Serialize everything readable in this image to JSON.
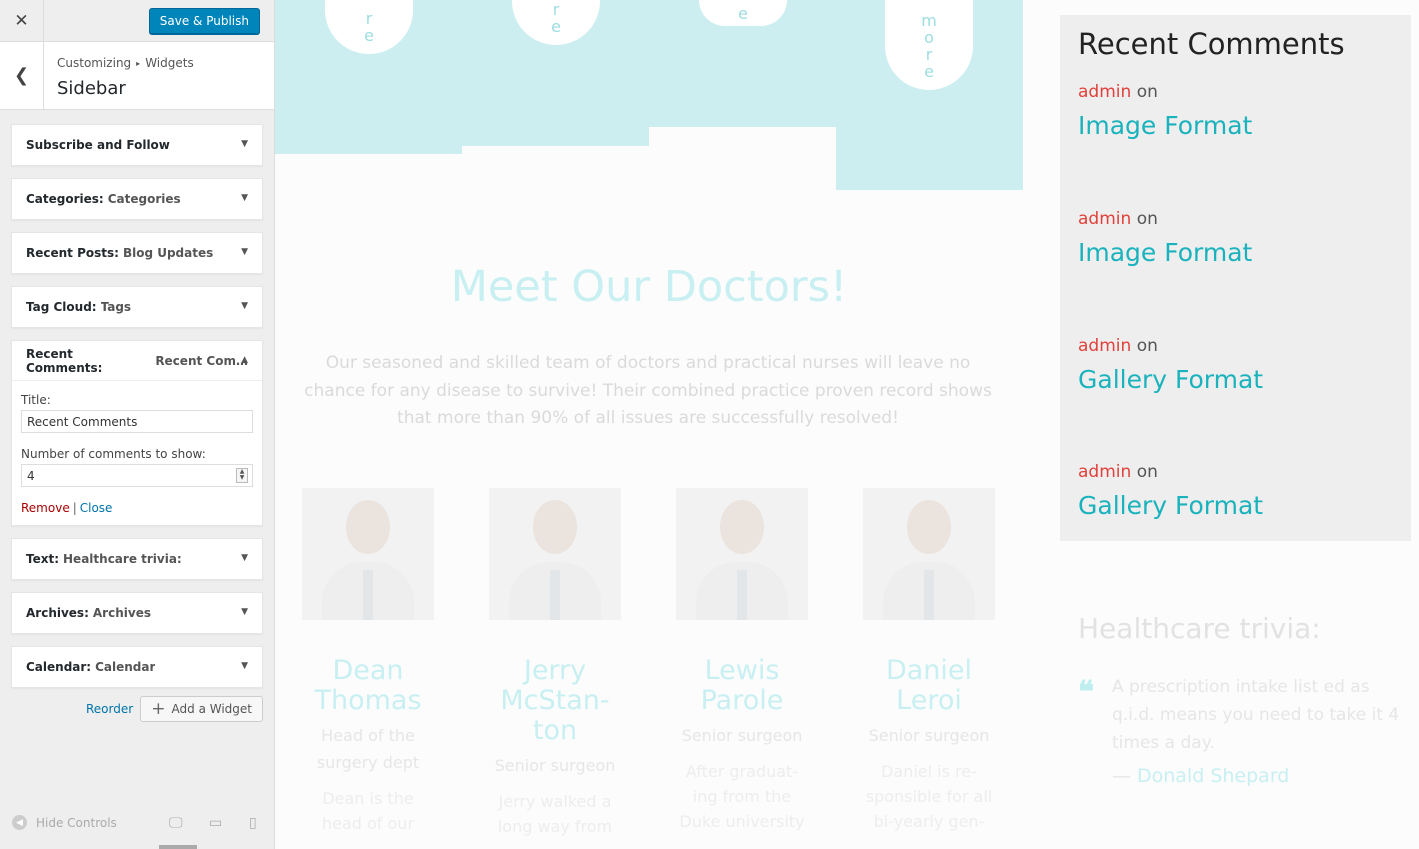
{
  "customizer": {
    "close_glyph": "✕",
    "publish_label": "Save & Publish",
    "back_glyph": "❮",
    "breadcrumb": [
      "Customizing",
      "Widgets"
    ],
    "breadcrumb_sep": "▸",
    "section_title": "Sidebar",
    "widgets": [
      {
        "type": "Subscribe and Follow",
        "title": "",
        "open": false
      },
      {
        "type": "Categories:",
        "title": "Categories",
        "open": false
      },
      {
        "type": "Recent Posts:",
        "title": "Blog Updates",
        "open": false
      },
      {
        "type": "Tag Cloud:",
        "title": "Tags",
        "open": false
      },
      {
        "type": "Recent Comments:",
        "title": "Recent Com...",
        "open": true
      },
      {
        "type": "Text:",
        "title": "Healthcare trivia:",
        "open": false
      },
      {
        "type": "Archives:",
        "title": "Archives",
        "open": false
      },
      {
        "type": "Calendar:",
        "title": "Calendar",
        "open": false
      }
    ],
    "open_widget_form": {
      "title_label": "Title:",
      "title_value": "Recent Comments",
      "count_label": "Number of comments to show:",
      "count_value": "4",
      "remove_label": "Remove",
      "separator": "|",
      "close_label": "Close"
    },
    "toggle_closed_glyph": "▼",
    "toggle_open_glyph": "▲",
    "reorder_label": "Reorder",
    "add_widget_label": "Add a Widget",
    "add_glyph": "+",
    "hide_controls_label": "Hide Controls",
    "hide_glyph": "◀",
    "device_glyphs": {
      "desktop": "🖵",
      "tablet": "▭",
      "mobile": "▯"
    }
  },
  "preview": {
    "pill_texts": [
      "r\ne",
      "r\ne",
      "e",
      "m\no\nr\ne"
    ],
    "meet_title": "Meet Our Doctors!",
    "meet_desc": "Our seasoned and skilled team of doctors and practical nurses will leave no chance for any disease to survive! Their combined practice proven record shows that more than 90% of all issues are successfully resolved!",
    "doctors": [
      {
        "name": "Dean\nThomas",
        "role": "Head of the\nsurgery dept",
        "bio": "Dean is the\nhead of our"
      },
      {
        "name": "Jerry\nMcStan-\nton",
        "role": "Senior surgeon",
        "bio": "Jerry walked a\nlong way from"
      },
      {
        "name": "Lewis\nParole",
        "role": "Senior surgeon",
        "bio": "After graduat-\ning from the\nDuke university"
      },
      {
        "name": "Daniel\nLeroi",
        "role": "Senior surgeon",
        "bio": "Daniel is re-\nsponsible for all\nbi-yearly gen-"
      }
    ],
    "recent_comments": {
      "title": "Recent Comments",
      "items": [
        {
          "author": "admin",
          "on": "on",
          "post": "Image Format"
        },
        {
          "author": "admin",
          "on": "on",
          "post": "Image Format"
        },
        {
          "author": "admin",
          "on": "on",
          "post": "Gallery Format"
        },
        {
          "author": "admin",
          "on": "on",
          "post": "Gallery Format"
        }
      ]
    },
    "trivia": {
      "title": "Healthcare trivia:",
      "quote_glyph": "❝",
      "text": "A prescription intake list ed as q.i.d. means you need to take it 4 times a day.",
      "dash": "—",
      "author": "Donald Shepard"
    },
    "colors": {
      "accent": "#1ab3bd",
      "author": "#e0413a",
      "publish": "#0085ba",
      "band": "#cceef0"
    }
  }
}
